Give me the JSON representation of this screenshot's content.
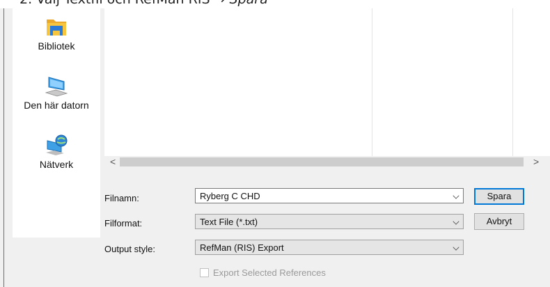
{
  "instruction": {
    "prefix": "2.   Välj Textfil och RefMan RIS → ",
    "emphasis": "Spara"
  },
  "sidebar": {
    "items": [
      {
        "label": "Bibliotek",
        "icon": "library-folder-icon"
      },
      {
        "label": "Den här datorn",
        "icon": "computer-icon"
      },
      {
        "label": "Nätverk",
        "icon": "network-globe-icon"
      }
    ]
  },
  "scrollbar": {
    "left_arrow": "<",
    "right_arrow": ">"
  },
  "form": {
    "filename_label": "Filnamn:",
    "filename_value": "Ryberg C CHD",
    "format_label": "Filformat:",
    "format_value": "Text File (*.txt)",
    "output_label": "Output style:",
    "output_value": "RefMan (RIS) Export",
    "export_selected_label": "Export Selected References"
  },
  "buttons": {
    "save": "Spara",
    "cancel": "Avbryt"
  }
}
